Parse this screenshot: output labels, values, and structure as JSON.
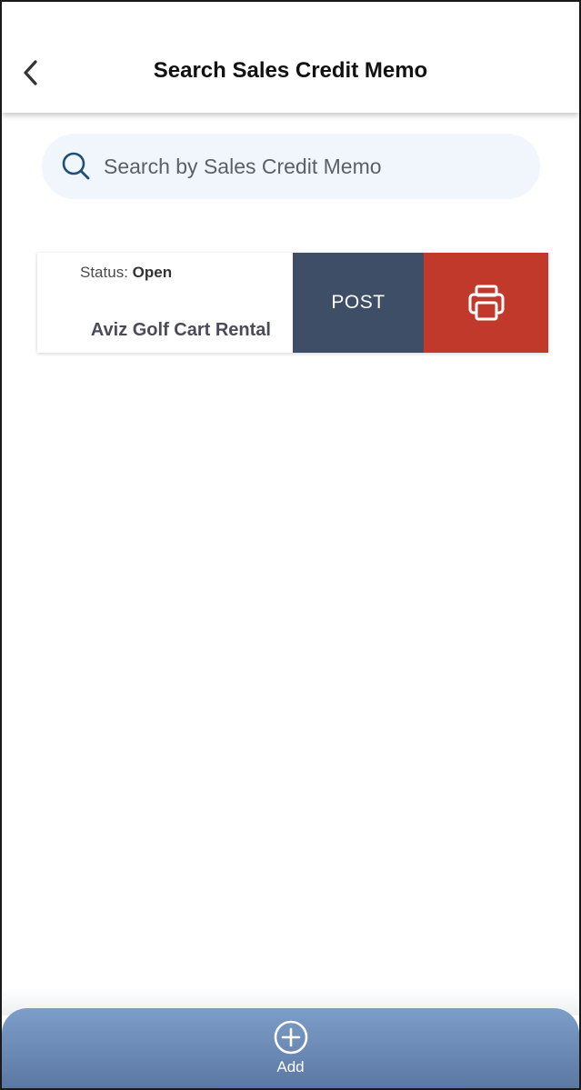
{
  "header": {
    "title": "Search Sales Credit Memo",
    "back_icon": "chevron-left-icon"
  },
  "search": {
    "placeholder": "Search by Sales Credit Memo",
    "value": "",
    "icon": "search-icon"
  },
  "memos": [
    {
      "status_label": "Status: ",
      "status_value": "Open",
      "customer": "Aviz Golf Cart Rental",
      "post_label": "POST",
      "print_icon": "printer-icon"
    }
  ],
  "bottom_bar": {
    "add_label": "Add",
    "add_icon": "plus-circle-icon"
  },
  "colors": {
    "post": "#3e4e66",
    "print": "#c0392b",
    "search_bg": "#f0f6fc",
    "bottom_bar": "#6b8bb8"
  }
}
